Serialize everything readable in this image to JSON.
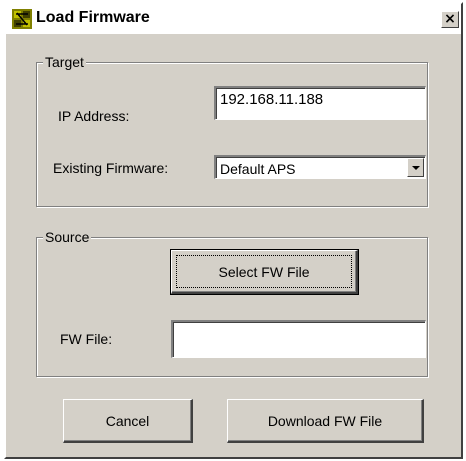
{
  "window": {
    "title": "Load Firmware",
    "close_label": "×"
  },
  "target": {
    "legend": "Target",
    "ip_label": "IP Address:",
    "ip_value": "192.168.11.188",
    "fw_label": "Existing Firmware:",
    "fw_selected": "Default APS"
  },
  "source": {
    "legend": "Source",
    "select_button": "Select FW File",
    "file_label": "FW File:",
    "file_value": ""
  },
  "actions": {
    "cancel": "Cancel",
    "download": "Download FW File"
  },
  "colors": {
    "face": "#d4d0c8",
    "shadow": "#808080",
    "highlight": "#ffffff"
  }
}
